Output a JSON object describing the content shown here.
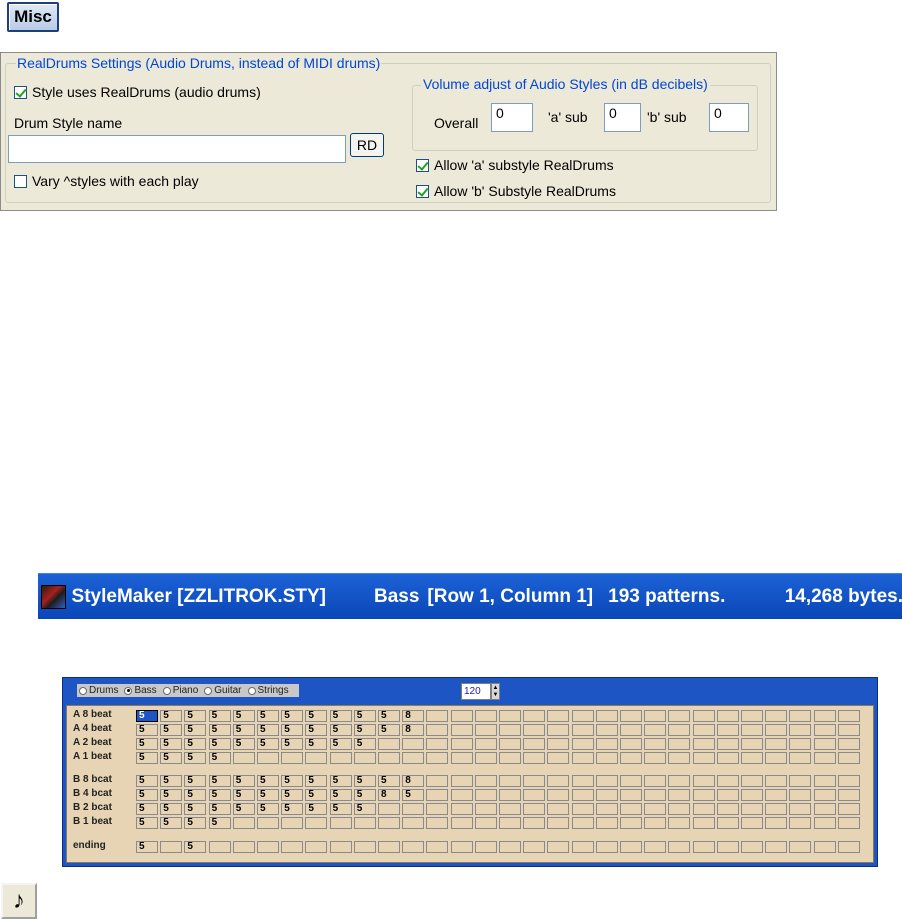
{
  "misc_button": {
    "label": "Misc"
  },
  "realdrums": {
    "group_title": "RealDrums Settings (Audio Drums, instead of MIDI drums)",
    "style_uses_realdrums": {
      "label": "Style uses RealDrums (audio drums)",
      "checked": true
    },
    "drum_style_name_label": "Drum Style name",
    "drum_style_name_value": "",
    "rd_button": "RD",
    "vary_styles": {
      "label": "Vary ^styles with each play",
      "checked": false
    },
    "volume_group": {
      "title": "Volume adjust of Audio Styles (in dB decibels)",
      "overall_label": "Overall",
      "overall_value": "0",
      "a_sub_label": "'a' sub",
      "a_sub_value": "0",
      "b_sub_label": "'b' sub",
      "b_sub_value": "0"
    },
    "allow_a": {
      "label": "Allow 'a' substyle RealDrums",
      "checked": true
    },
    "allow_b": {
      "label": "Allow 'b' Substyle RealDrums",
      "checked": true
    }
  },
  "stylemaker_title": {
    "app_name": "StyleMaker [ZZLITROK.STY]",
    "instrument": "Bass",
    "position": "[Row 1, Column 1]",
    "patterns": "193 patterns.",
    "bytes": "14,268 bytes."
  },
  "pattern_grid": {
    "instruments": [
      "Drums",
      "Bass",
      "Piano",
      "Guitar",
      "Strings"
    ],
    "selected_instrument": "Bass",
    "tempo": "120",
    "columns": 30,
    "rows": [
      {
        "label": "A 8 beat",
        "values": [
          "5",
          "5",
          "5",
          "5",
          "5",
          "5",
          "5",
          "5",
          "5",
          "5",
          "5",
          "8"
        ]
      },
      {
        "label": "A 4 beat",
        "values": [
          "5",
          "5",
          "5",
          "5",
          "5",
          "5",
          "5",
          "5",
          "5",
          "5",
          "5",
          "8"
        ]
      },
      {
        "label": "A 2 beat",
        "values": [
          "5",
          "5",
          "5",
          "5",
          "5",
          "5",
          "5",
          "5",
          "5",
          "5"
        ]
      },
      {
        "label": "A 1 beat",
        "values": [
          "5",
          "5",
          "5",
          "5"
        ]
      },
      {
        "label": "B 8 bcat",
        "values": [
          "5",
          "5",
          "5",
          "5",
          "5",
          "5",
          "5",
          "5",
          "5",
          "5",
          "5",
          "8"
        ]
      },
      {
        "label": "B 4 bcat",
        "values": [
          "5",
          "5",
          "5",
          "5",
          "5",
          "5",
          "5",
          "5",
          "5",
          "5",
          "8",
          "5"
        ]
      },
      {
        "label": "B 2 bcat",
        "values": [
          "5",
          "5",
          "5",
          "5",
          "5",
          "5",
          "5",
          "5",
          "5",
          "5"
        ]
      },
      {
        "label": "B 1 beat",
        "values": [
          "5",
          "5",
          "5",
          "5"
        ]
      },
      {
        "label": "ending",
        "values": [
          "5",
          "",
          "5"
        ]
      }
    ]
  },
  "note_button": {
    "glyph": "♪"
  }
}
